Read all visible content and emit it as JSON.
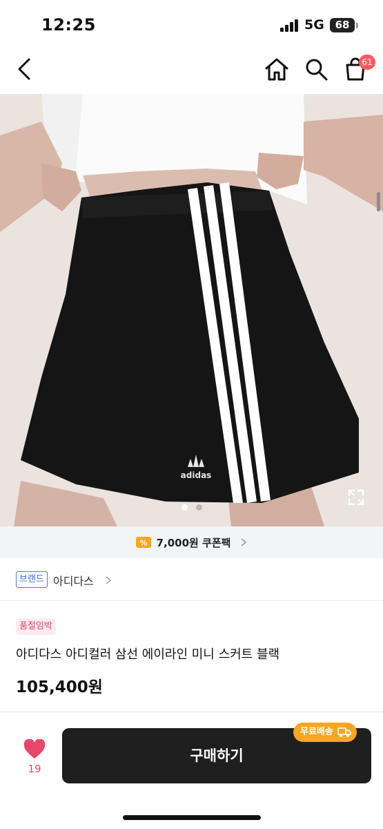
{
  "status_bar": {
    "time": "12:25",
    "network": "5G",
    "battery": "68"
  },
  "nav": {
    "cart_count": "61"
  },
  "hero": {
    "alt": "adidas 3-stripe mini skirt",
    "logo_text": "adidas",
    "pager_total": 2,
    "pager_active": 1
  },
  "coupon": {
    "icon_label": "%",
    "text": "7,000원 쿠폰팩"
  },
  "brand": {
    "tag": "브랜드",
    "name": "아디다스"
  },
  "product": {
    "badge": "품절임박",
    "title": "아디다스 아디컬러 삼선 에이라인 미니 스커트 블랙",
    "price": "105,400원"
  },
  "bottom": {
    "like_count": "19",
    "buy_label": "구매하기",
    "free_shipping": "무료배송"
  },
  "colors": {
    "like": "#e8466a",
    "coupon": "#f5a623",
    "brand_tag": "#3b6fd4",
    "buy_button": "#1f1f1f",
    "free_ship": "#f6a623"
  }
}
